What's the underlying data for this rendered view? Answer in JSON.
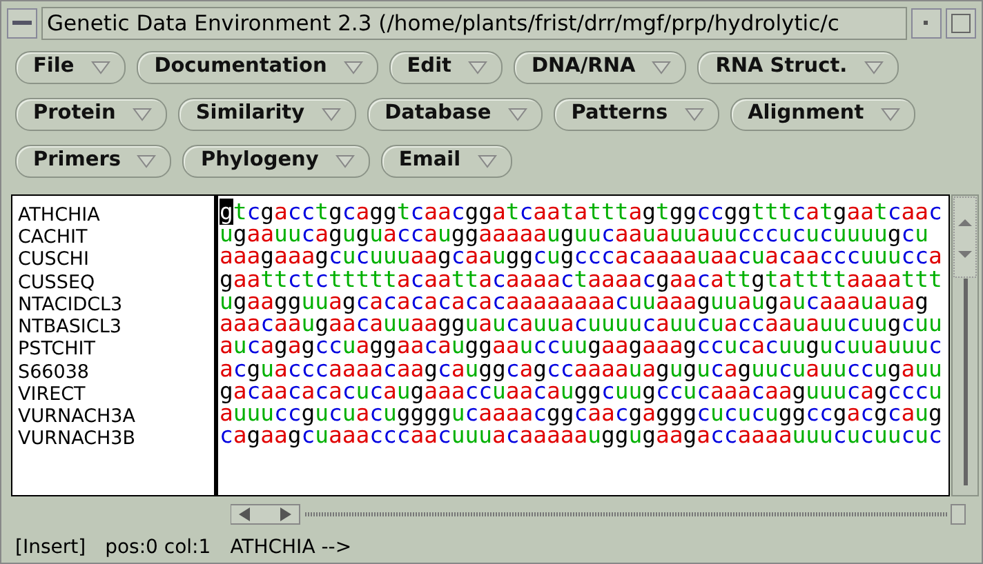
{
  "window": {
    "title": "Genetic Data Environment 2.3 (/home/plants/frist/drr/mgf/prp/hydrolytic/c"
  },
  "menus": [
    [
      "File",
      "Documentation",
      "Edit",
      "DNA/RNA",
      "RNA Struct."
    ],
    [
      "Protein",
      "Similarity",
      "Database",
      "Patterns",
      "Alignment"
    ],
    [
      "Primers",
      "Phylogeny",
      "Email"
    ]
  ],
  "sequences": [
    {
      "name": "ATHCHIA",
      "bases": "gtcgacctgcaggtcaacggatcaatatttagtggccggtttcatgaatcaac",
      "cursor": true
    },
    {
      "name": "CACHIT",
      "bases": "ugaauucaguguaccauggaaaaauguucaauauuauucccucucuuuugcu",
      "cursor": false
    },
    {
      "name": "CUSCHI",
      "bases": "aaagaaagcucuuuaagcaauggcugcccacaaaauaacuacaacccuuucca",
      "cursor": false
    },
    {
      "name": "CUSSEQ",
      "bases": "gaattctctttttacaattacaaaactaaaacgaacattgtattttaaaattt",
      "cursor": false
    },
    {
      "name": "NTACIDCL3",
      "bases": "ugaagguuagcacacacacacaaaaaaaacuuaaaguuaugaucaaauauag",
      "cursor": false
    },
    {
      "name": "NTBASICL3",
      "bases": "aaacaaugaacauuaagguaucauuacuuuucauucuaccaauauucuugcuu",
      "cursor": false
    },
    {
      "name": "PSTCHIT",
      "bases": "aucagagccuaggaacauggaauccuugaagaaagccucacuugucuuauuuc",
      "cursor": false
    },
    {
      "name": "S66038",
      "bases": "acguacccaaaacaagcauggcagccaaaauagugucaguucuauuccugauu",
      "cursor": false
    },
    {
      "name": "VIRECT",
      "bases": "gacaacacacucaugaaaccuaacauggcuugccucaaacaaguuucagcccu",
      "cursor": false
    },
    {
      "name": "VURNACH3A",
      "bases": "auuuccgucuacuggggucaaaacggcaacgagggcucucuggccgacgcaug",
      "cursor": false
    },
    {
      "name": "VURNACH3B",
      "bases": "cagaagcuaaacccaacuuuacaaaaauggugaagaccaaaauuucucuucuc",
      "cursor": false
    }
  ],
  "status_bar": {
    "mode": "[Insert]",
    "position": "pos:0 col:1",
    "sequence": "ATHCHIA -->"
  }
}
